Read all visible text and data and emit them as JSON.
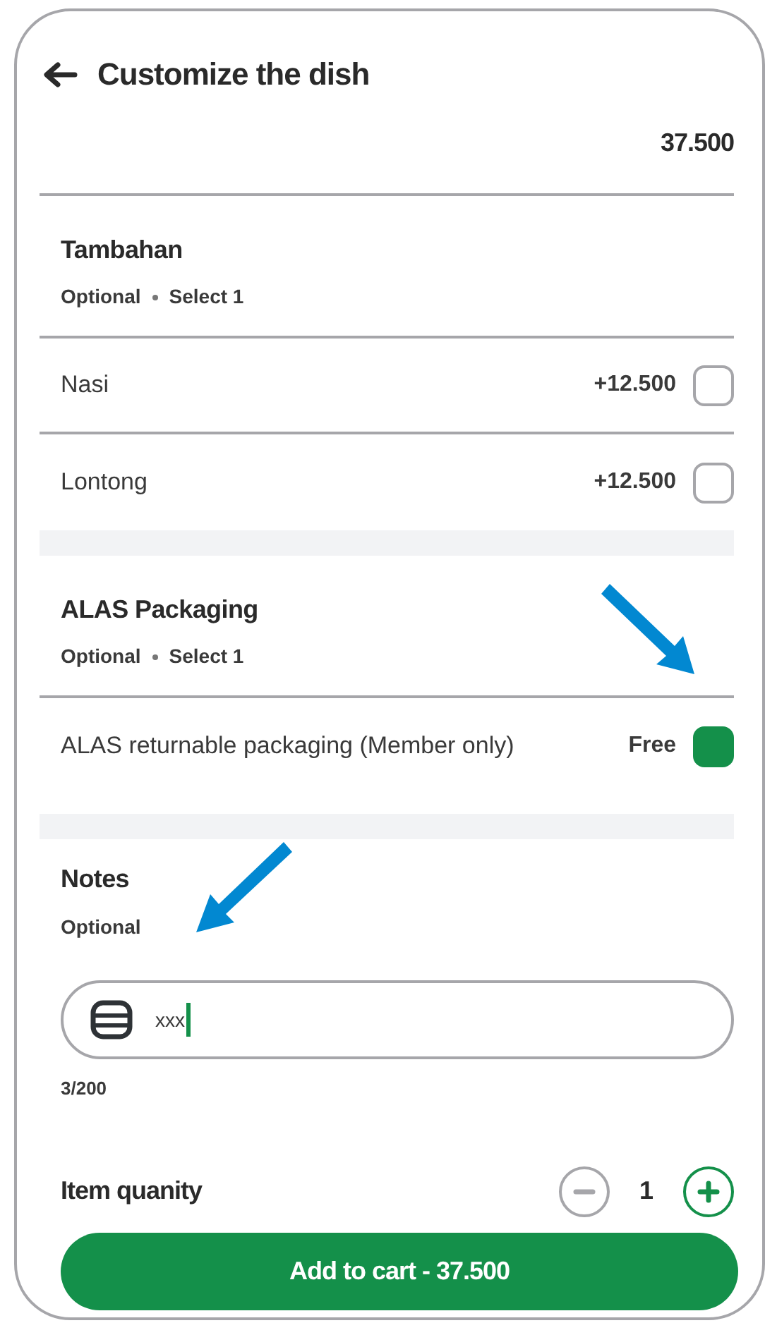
{
  "header": {
    "title": "Customize the dish"
  },
  "base_price": "37.500",
  "sections": [
    {
      "title": "Tambahan",
      "requirement": "Optional",
      "rule": "Select 1",
      "options": [
        {
          "label": "Nasi",
          "price": "+12.500",
          "checked": false
        },
        {
          "label": "Lontong",
          "price": "+12.500",
          "checked": false
        }
      ]
    },
    {
      "title": "ALAS Packaging",
      "requirement": "Optional",
      "rule": "Select 1",
      "options": [
        {
          "label": "ALAS returnable packaging (Member only)",
          "price": "Free",
          "checked": true
        }
      ]
    }
  ],
  "notes": {
    "title": "Notes",
    "requirement": "Optional",
    "value": "xxx",
    "counter": "3/200"
  },
  "quantity": {
    "label": "Item quanity",
    "value": "1",
    "minus_disabled": true
  },
  "add_button": {
    "label": "Add to cart - 37.500"
  }
}
